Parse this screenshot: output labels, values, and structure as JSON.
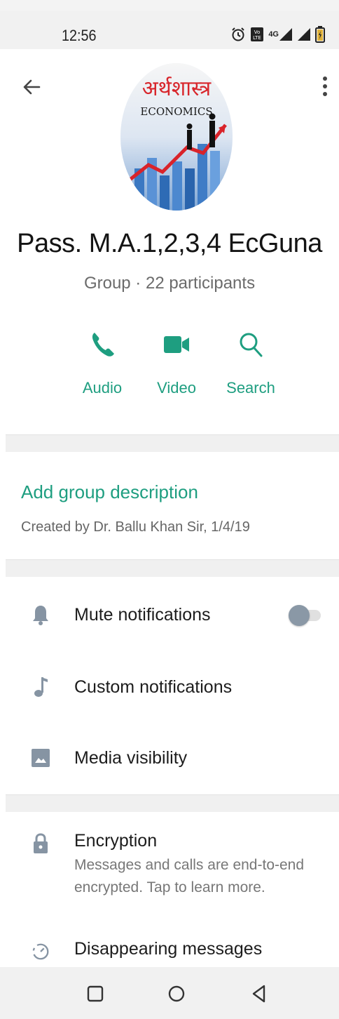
{
  "status_bar": {
    "time": "12:56",
    "network": "4G",
    "icons": [
      "alarm-icon",
      "volte-icon",
      "signal-4g-icon",
      "signal-icon",
      "battery-charging-icon"
    ]
  },
  "header": {
    "group_name": "Pass. M.A.1,2,3,4 EcGuna",
    "subtitle": "Group · 22 participants",
    "avatar_text_top": "अर्थशास्त्र",
    "avatar_text_bottom": "ECONOMICS"
  },
  "actions": [
    {
      "label": "Audio",
      "icon": "phone-icon"
    },
    {
      "label": "Video",
      "icon": "video-camera-icon"
    },
    {
      "label": "Search",
      "icon": "search-icon"
    }
  ],
  "description": {
    "add_label": "Add group description",
    "created": "Created by Dr. Ballu Khan Sir, 1/4/19"
  },
  "settings": {
    "mute": "Mute notifications",
    "mute_enabled": false,
    "custom": "Custom notifications",
    "media": "Media visibility"
  },
  "security": {
    "encryption_title": "Encryption",
    "encryption_sub_1": "Messages and calls are end-to-end",
    "encryption_sub_2": "encrypted. Tap to learn more.",
    "disappearing_title": "Disappearing messages"
  },
  "colors": {
    "accent": "#1e9e80",
    "icon_gray": "#8694a3"
  }
}
